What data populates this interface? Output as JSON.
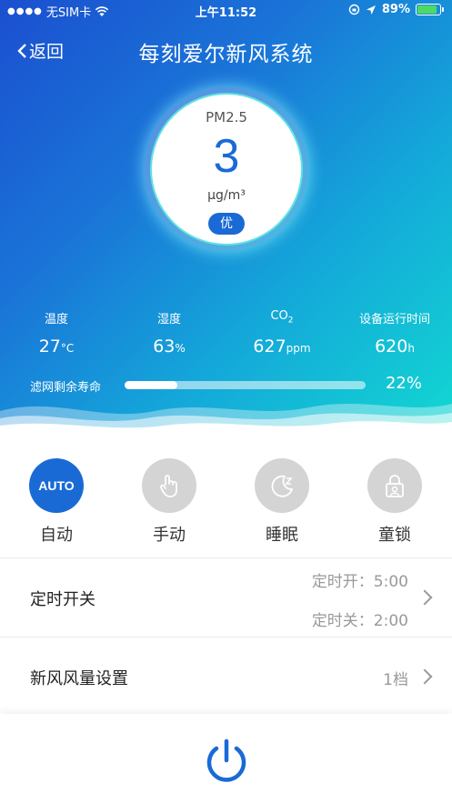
{
  "status_bar": {
    "carrier": "无SIM卡",
    "time": "上午11:52",
    "battery": "89%",
    "icons": [
      "wifi-icon",
      "orientation-lock-icon",
      "location-icon",
      "battery-icon"
    ]
  },
  "nav": {
    "back_label": "返回",
    "title": "每刻爱尔新风系统"
  },
  "pm": {
    "label": "PM2.5",
    "value": "3",
    "unit": "μg/m³",
    "quality": "优"
  },
  "stats": [
    {
      "label": "温度",
      "value": "27",
      "unit": "°C"
    },
    {
      "label": "湿度",
      "value": "63",
      "unit": "%"
    },
    {
      "label": "CO",
      "label_sub": "2",
      "value": "627",
      "unit": "ppm"
    },
    {
      "label": "设备运行时间",
      "value": "620",
      "unit": "h"
    }
  ],
  "filter": {
    "label": "滤网剩余寿命",
    "percent_text": "22%",
    "percent": 22
  },
  "modes": [
    {
      "label": "自动",
      "icon_text": "AUTO",
      "icon": "auto-icon",
      "active": true
    },
    {
      "label": "手动",
      "icon": "hand-tap-icon",
      "active": false
    },
    {
      "label": "睡眠",
      "icon": "moon-sleep-icon",
      "active": false
    },
    {
      "label": "童锁",
      "icon": "child-lock-icon",
      "active": false
    }
  ],
  "timer": {
    "title": "定时开关",
    "on_text": "定时开：5:00",
    "off_text": "定时关：2:00"
  },
  "airflow": {
    "title": "新风风量设置",
    "value": "1档"
  },
  "colors": {
    "accent": "#1a6ad6",
    "gradient_start": "#1b4fd0",
    "gradient_end": "#12d8d2",
    "mode_inactive": "#d4d4d4"
  }
}
